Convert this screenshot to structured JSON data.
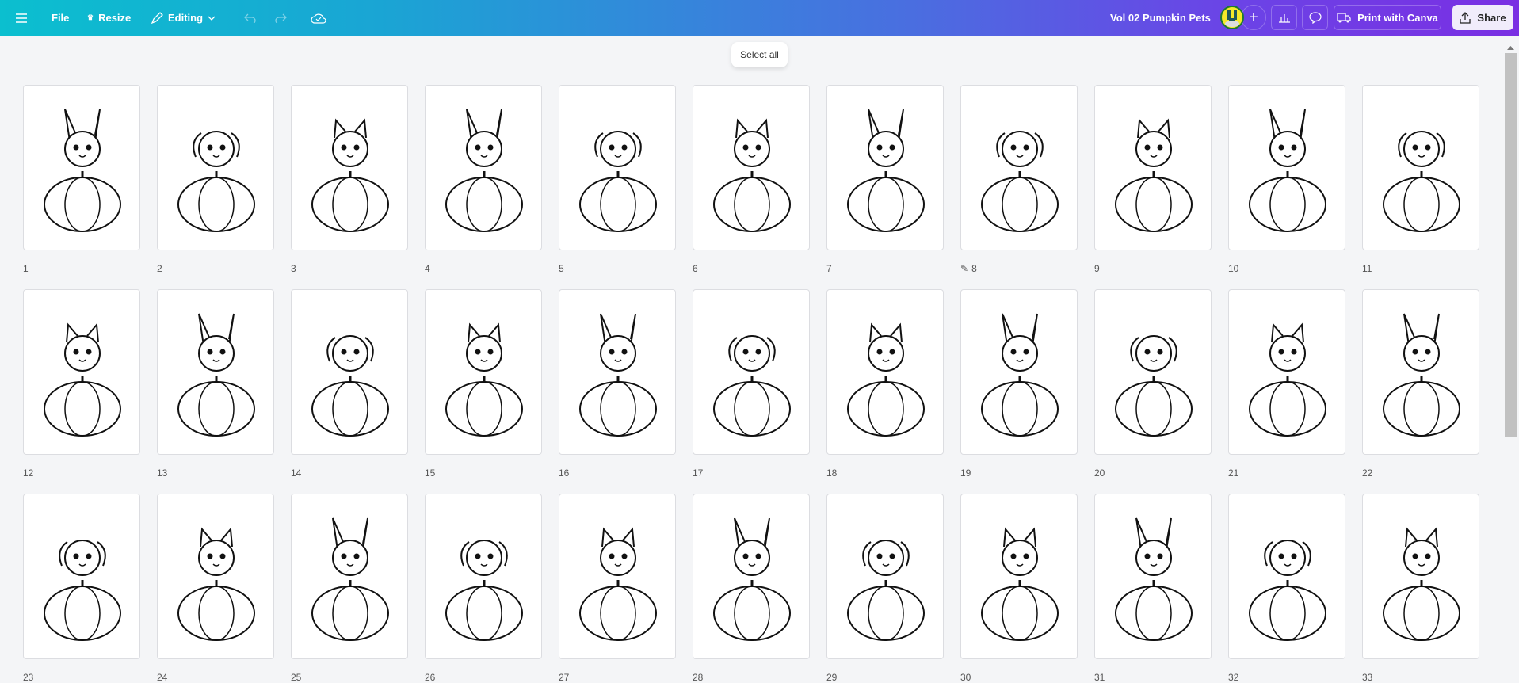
{
  "toolbar": {
    "menu_icon": "hamburger-icon",
    "file": "File",
    "resize": "Resize",
    "editing": "Editing",
    "undo_icon": "undo-icon",
    "redo_icon": "redo-icon",
    "save_icon": "cloud-check-icon"
  },
  "header": {
    "title": "Vol 02 Pumpkin Pets",
    "add_icon": "plus-icon",
    "insights_icon": "bar-chart-icon",
    "comment_icon": "comment-icon",
    "print": "Print with Canva",
    "share": "Share"
  },
  "tooltip": {
    "select_all": "Select all"
  },
  "pages": [
    {
      "n": "1"
    },
    {
      "n": "2"
    },
    {
      "n": "3"
    },
    {
      "n": "4"
    },
    {
      "n": "5"
    },
    {
      "n": "6"
    },
    {
      "n": "7"
    },
    {
      "n": "8",
      "note_icon": true
    },
    {
      "n": "9"
    },
    {
      "n": "10"
    },
    {
      "n": "11"
    },
    {
      "n": "12"
    },
    {
      "n": "13"
    },
    {
      "n": "14"
    },
    {
      "n": "15"
    },
    {
      "n": "16"
    },
    {
      "n": "17"
    },
    {
      "n": "18"
    },
    {
      "n": "19"
    },
    {
      "n": "20"
    },
    {
      "n": "21"
    },
    {
      "n": "22"
    },
    {
      "n": "23"
    },
    {
      "n": "24"
    },
    {
      "n": "25"
    },
    {
      "n": "26"
    },
    {
      "n": "27"
    },
    {
      "n": "28"
    },
    {
      "n": "29"
    },
    {
      "n": "30"
    },
    {
      "n": "31"
    },
    {
      "n": "32"
    },
    {
      "n": "33"
    }
  ],
  "colors": {
    "gradient_start": "#0bbfcf",
    "gradient_end": "#7a2fe3"
  }
}
